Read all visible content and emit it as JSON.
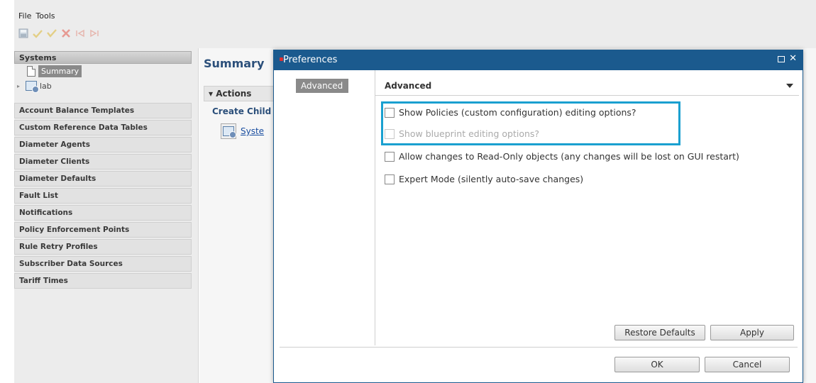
{
  "menu": {
    "items": [
      "File",
      "Tools"
    ]
  },
  "toolbar": {
    "icons": [
      "save-icon",
      "check-icon",
      "check-alt-icon",
      "delete-icon",
      "prev-icon",
      "next-icon"
    ]
  },
  "sidebar": {
    "header": "Systems",
    "tree": {
      "selected_label": "Summary",
      "child_label": "lab"
    },
    "items": [
      "Account Balance Templates",
      "Custom Reference Data Tables",
      "Diameter Agents",
      "Diameter Clients",
      "Diameter Defaults",
      "Fault List",
      "Notifications",
      "Policy Enforcement Points",
      "Rule Retry Profiles",
      "Subscriber Data Sources",
      "Tariff Times"
    ]
  },
  "main": {
    "title": "Summary",
    "actions_label": "Actions",
    "create_child_label": "Create Child",
    "link_label": "Syste"
  },
  "dialog": {
    "title": "Preferences",
    "left_tab": "Advanced",
    "section_title": "Advanced",
    "options": [
      {
        "label": "Show Policies (custom configuration) editing options?",
        "checked": false,
        "enabled": true
      },
      {
        "label": "Show blueprint editing options?",
        "checked": false,
        "enabled": false
      },
      {
        "label": "Allow changes to Read-Only objects (any changes will be lost on GUI restart)",
        "checked": false,
        "enabled": true
      },
      {
        "label": "Expert Mode (silently auto-save changes)",
        "checked": false,
        "enabled": true
      }
    ],
    "buttons": {
      "restore": "Restore Defaults",
      "apply": "Apply",
      "ok": "OK",
      "cancel": "Cancel"
    }
  },
  "colors": {
    "title_bar": "#1b5a8e",
    "highlight": "#1aa0d0",
    "link": "#1a4ea0"
  }
}
